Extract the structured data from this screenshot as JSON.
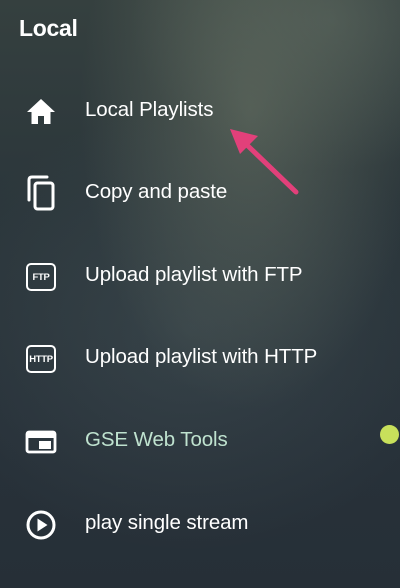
{
  "section": {
    "title": "Local"
  },
  "menu": {
    "items": [
      {
        "label": "Local Playlists",
        "icon": "home-icon"
      },
      {
        "label": "Copy and paste",
        "icon": "copy-icon"
      },
      {
        "label": "Upload playlist with FTP",
        "icon": "ftp-icon",
        "badge": "FTP"
      },
      {
        "label": "Upload playlist with HTTP",
        "icon": "http-icon",
        "badge": "HTTP"
      },
      {
        "label": "GSE Web Tools",
        "icon": "web-tools-icon",
        "active": true
      },
      {
        "label": "play single stream",
        "icon": "play-circle-icon"
      }
    ]
  },
  "colors": {
    "text": "#ffffff",
    "active_item_text": "#bfe2cf",
    "indicator_dot": "#c8e05b",
    "annotation_arrow": "#e2407a"
  }
}
